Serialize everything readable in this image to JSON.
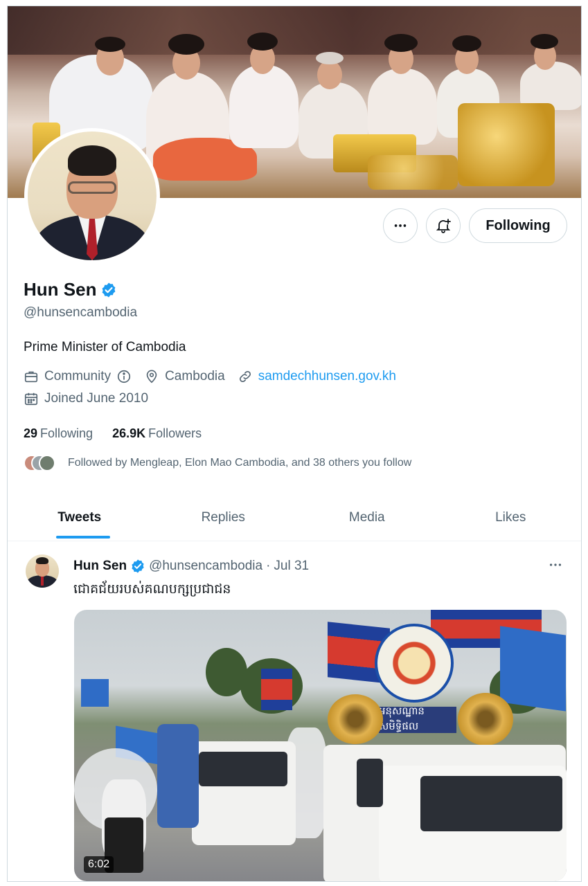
{
  "profile": {
    "name": "Hun Sen",
    "handle": "@hunsencambodia",
    "bio": "Prime Minister of Cambodia",
    "category": "Community",
    "location": "Cambodia",
    "website": "samdechhunsen.gov.kh",
    "joined": "Joined June 2010",
    "following_count": "29",
    "following_label": "Following",
    "followers_count": "26.9K",
    "followers_label": "Followers",
    "followed_by": "Followed by Mengleap, Elon Mao Cambodia, and 38 others you follow",
    "verified": true
  },
  "actions": {
    "follow_state_label": "Following"
  },
  "tabs": [
    {
      "label": "Tweets",
      "active": true
    },
    {
      "label": "Replies",
      "active": false
    },
    {
      "label": "Media",
      "active": false
    },
    {
      "label": "Likes",
      "active": false
    }
  ],
  "tweet": {
    "author_name": "Hun Sen",
    "author_handle": "@hunsencambodia",
    "separator": "·",
    "date": "Jul 31",
    "text": "ជោគជ័យរបស់គណបក្សប្រជាជន",
    "video_duration": "6:02",
    "media_banner_text": "អនុសណ្ឋានសមិទ្ធិផល"
  },
  "colors": {
    "accent": "#1d9bf0",
    "text_primary": "#0f1419",
    "text_secondary": "#536471",
    "border": "#cfd9de"
  },
  "icons": {
    "verified": "verified-badge-icon",
    "more": "more-horizontal-icon",
    "notify": "bell-plus-icon",
    "category": "briefcase-icon",
    "info": "info-icon",
    "location": "location-pin-icon",
    "link": "link-icon",
    "calendar": "calendar-icon"
  }
}
